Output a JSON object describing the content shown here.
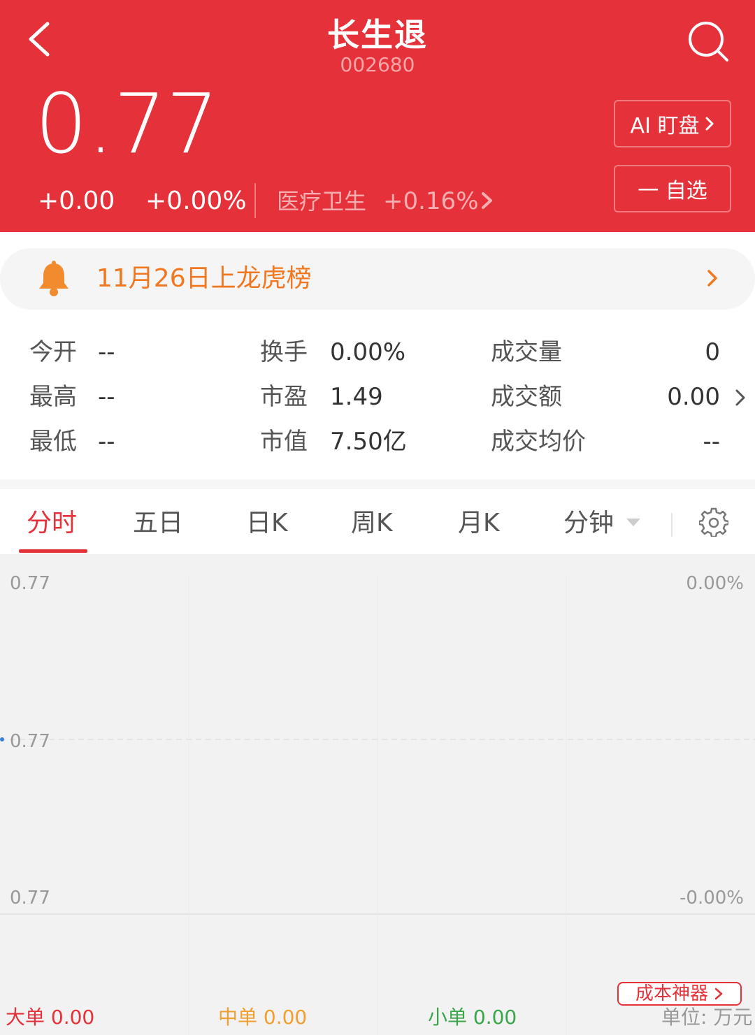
{
  "header": {
    "title": "长生退",
    "code": "002680",
    "price": "0.77",
    "change_abs": "+0.00",
    "change_pct": "+0.00%",
    "sector_name": "医疗卫生",
    "sector_change": "+0.16%",
    "ai_button": "AI 盯盘",
    "watch_button": "一 自选"
  },
  "alert": {
    "text": "11月26日上龙虎榜"
  },
  "stats": {
    "open_label": "今开",
    "open_value": "--",
    "high_label": "最高",
    "high_value": "--",
    "low_label": "最低",
    "low_value": "--",
    "turnover_label": "换手",
    "turnover_value": "0.00%",
    "pe_label": "市盈",
    "pe_value": "1.49",
    "mcap_label": "市值",
    "mcap_value": "7.50亿",
    "volume_label": "成交量",
    "volume_value": "0",
    "amount_label": "成交额",
    "amount_value": "0.00",
    "avg_label": "成交均价",
    "avg_value": "--"
  },
  "tabs": {
    "items": [
      {
        "label": "分时"
      },
      {
        "label": "五日"
      },
      {
        "label": "日K"
      },
      {
        "label": "周K"
      },
      {
        "label": "月K"
      },
      {
        "label": "分钟"
      }
    ],
    "active": "分时"
  },
  "chart_data": {
    "type": "line",
    "y_left_labels": [
      "0.77",
      "0.77",
      "0.77"
    ],
    "y_right_labels": [
      "0.00%",
      "-0.00%"
    ],
    "series": [],
    "grid": true
  },
  "bottom": {
    "cost_button": "成本神器",
    "big_order": "大单 0.00",
    "mid_order": "中单 0.00",
    "small_order": "小单 0.00",
    "unit": "单位: 万元"
  },
  "colors": {
    "header_red": "#e5323a",
    "alert_orange": "#f07820",
    "mid_order_orange": "#f0a030",
    "small_order_green": "#3aa64a"
  }
}
